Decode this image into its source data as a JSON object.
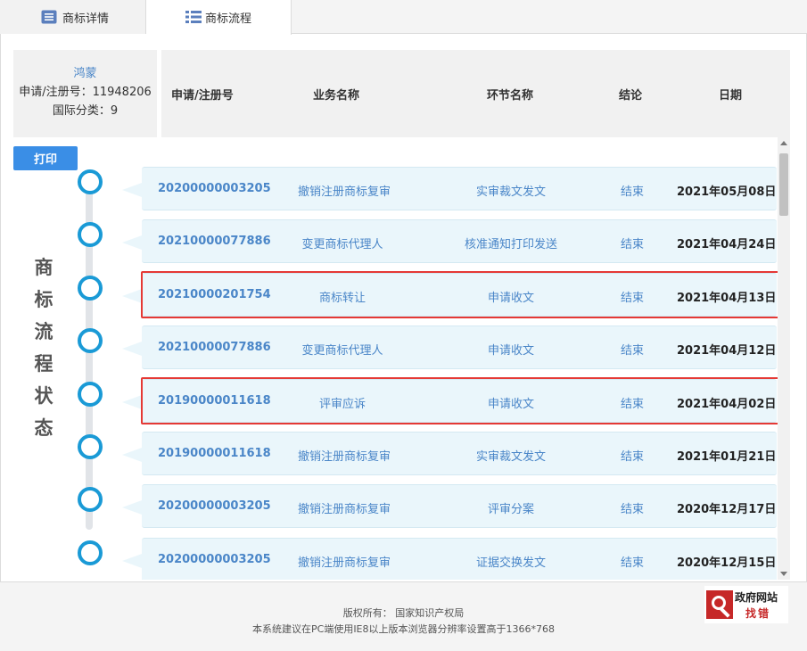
{
  "tabs": [
    {
      "label": "商标详情"
    },
    {
      "label": "商标流程"
    }
  ],
  "info": {
    "name": "鸿蒙",
    "reg_line": "申请/注册号：11948206",
    "class_line": "国际分类：9"
  },
  "table_header": {
    "no": "申请/注册号",
    "biz": "业务名称",
    "step": "环节名称",
    "result": "结论",
    "date": "日期"
  },
  "print_label": "打印",
  "side_title": [
    "商",
    "标",
    "流",
    "程",
    "状",
    "态"
  ],
  "rows": [
    {
      "no": "20200000003205",
      "biz": "撤销注册商标复审",
      "step": "实审裁文发文",
      "result": "结束",
      "date": "2021年05月08日",
      "highlight": false
    },
    {
      "no": "20210000077886",
      "biz": "变更商标代理人",
      "step": "核准通知打印发送",
      "result": "结束",
      "date": "2021年04月24日",
      "highlight": false
    },
    {
      "no": "20210000201754",
      "biz": "商标转让",
      "step": "申请收文",
      "result": "结束",
      "date": "2021年04月13日",
      "highlight": true
    },
    {
      "no": "20210000077886",
      "biz": "变更商标代理人",
      "step": "申请收文",
      "result": "结束",
      "date": "2021年04月12日",
      "highlight": false
    },
    {
      "no": "20190000011618",
      "biz": "评审应诉",
      "step": "申请收文",
      "result": "结束",
      "date": "2021年04月02日",
      "highlight": true
    },
    {
      "no": "20190000011618",
      "biz": "撤销注册商标复审",
      "step": "实审裁文发文",
      "result": "结束",
      "date": "2021年01月21日",
      "highlight": false
    },
    {
      "no": "20200000003205",
      "biz": "撤销注册商标复审",
      "step": "评审分案",
      "result": "结束",
      "date": "2020年12月17日",
      "highlight": false
    },
    {
      "no": "20200000003205",
      "biz": "撤销注册商标复审",
      "step": "证据交换发文",
      "result": "结束",
      "date": "2020年12月15日",
      "highlight": false
    }
  ],
  "footer": {
    "copyright": "版权所有：  国家知识产权局",
    "note": "本系统建议在PC端使用IE8以上版本浏览器分辨率设置高于1366*768"
  },
  "badge": {
    "line1": "政府网站",
    "line2": "找错"
  },
  "colors": {
    "accent": "#1a9ad6",
    "link": "#4a86c8",
    "highlight": "#e53935",
    "row_bg": "#eaf6fb"
  }
}
